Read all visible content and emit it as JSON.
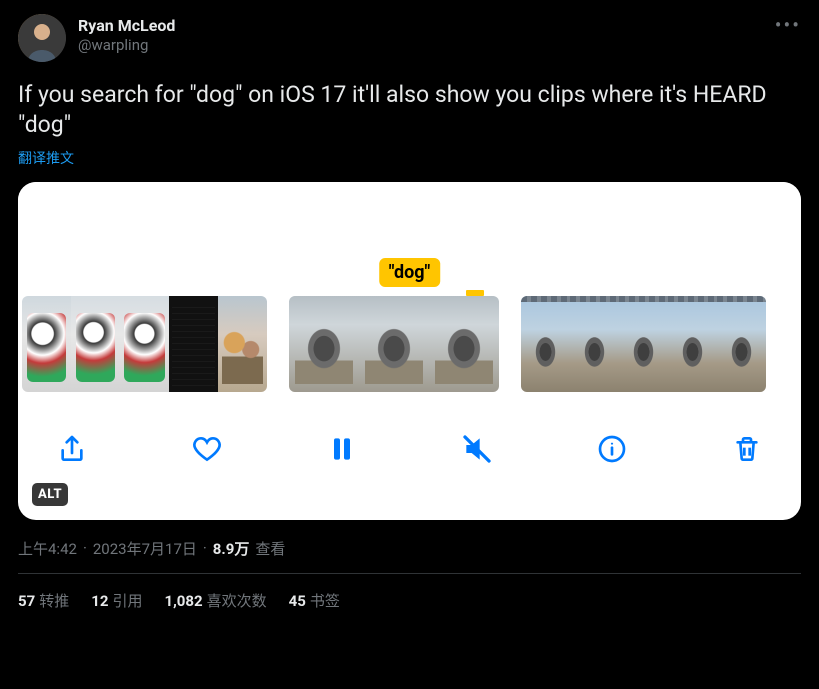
{
  "author": {
    "display_name": "Ryan McLeod",
    "handle": "@warpling"
  },
  "tweet_text": "If you search for \"dog\" on iOS 17 it'll also show you clips where it's HEARD \"dog\"",
  "translate_link": "翻译推文",
  "media": {
    "highlight_label": "\"dog\"",
    "alt_badge": "ALT"
  },
  "meta": {
    "time": "上午4:42",
    "date": "2023年7月17日",
    "views_count": "8.9万",
    "views_label": "查看"
  },
  "stats": {
    "retweets": {
      "count": "57",
      "label": "转推"
    },
    "quotes": {
      "count": "12",
      "label": "引用"
    },
    "likes": {
      "count": "1,082",
      "label": "喜欢次数"
    },
    "bookmarks": {
      "count": "45",
      "label": "书签"
    }
  },
  "icons": {
    "share": "share-icon",
    "heart": "heart-icon",
    "pause": "pause-icon",
    "mute": "mute-icon",
    "info": "info-icon",
    "trash": "trash-icon",
    "more": "more-icon"
  }
}
